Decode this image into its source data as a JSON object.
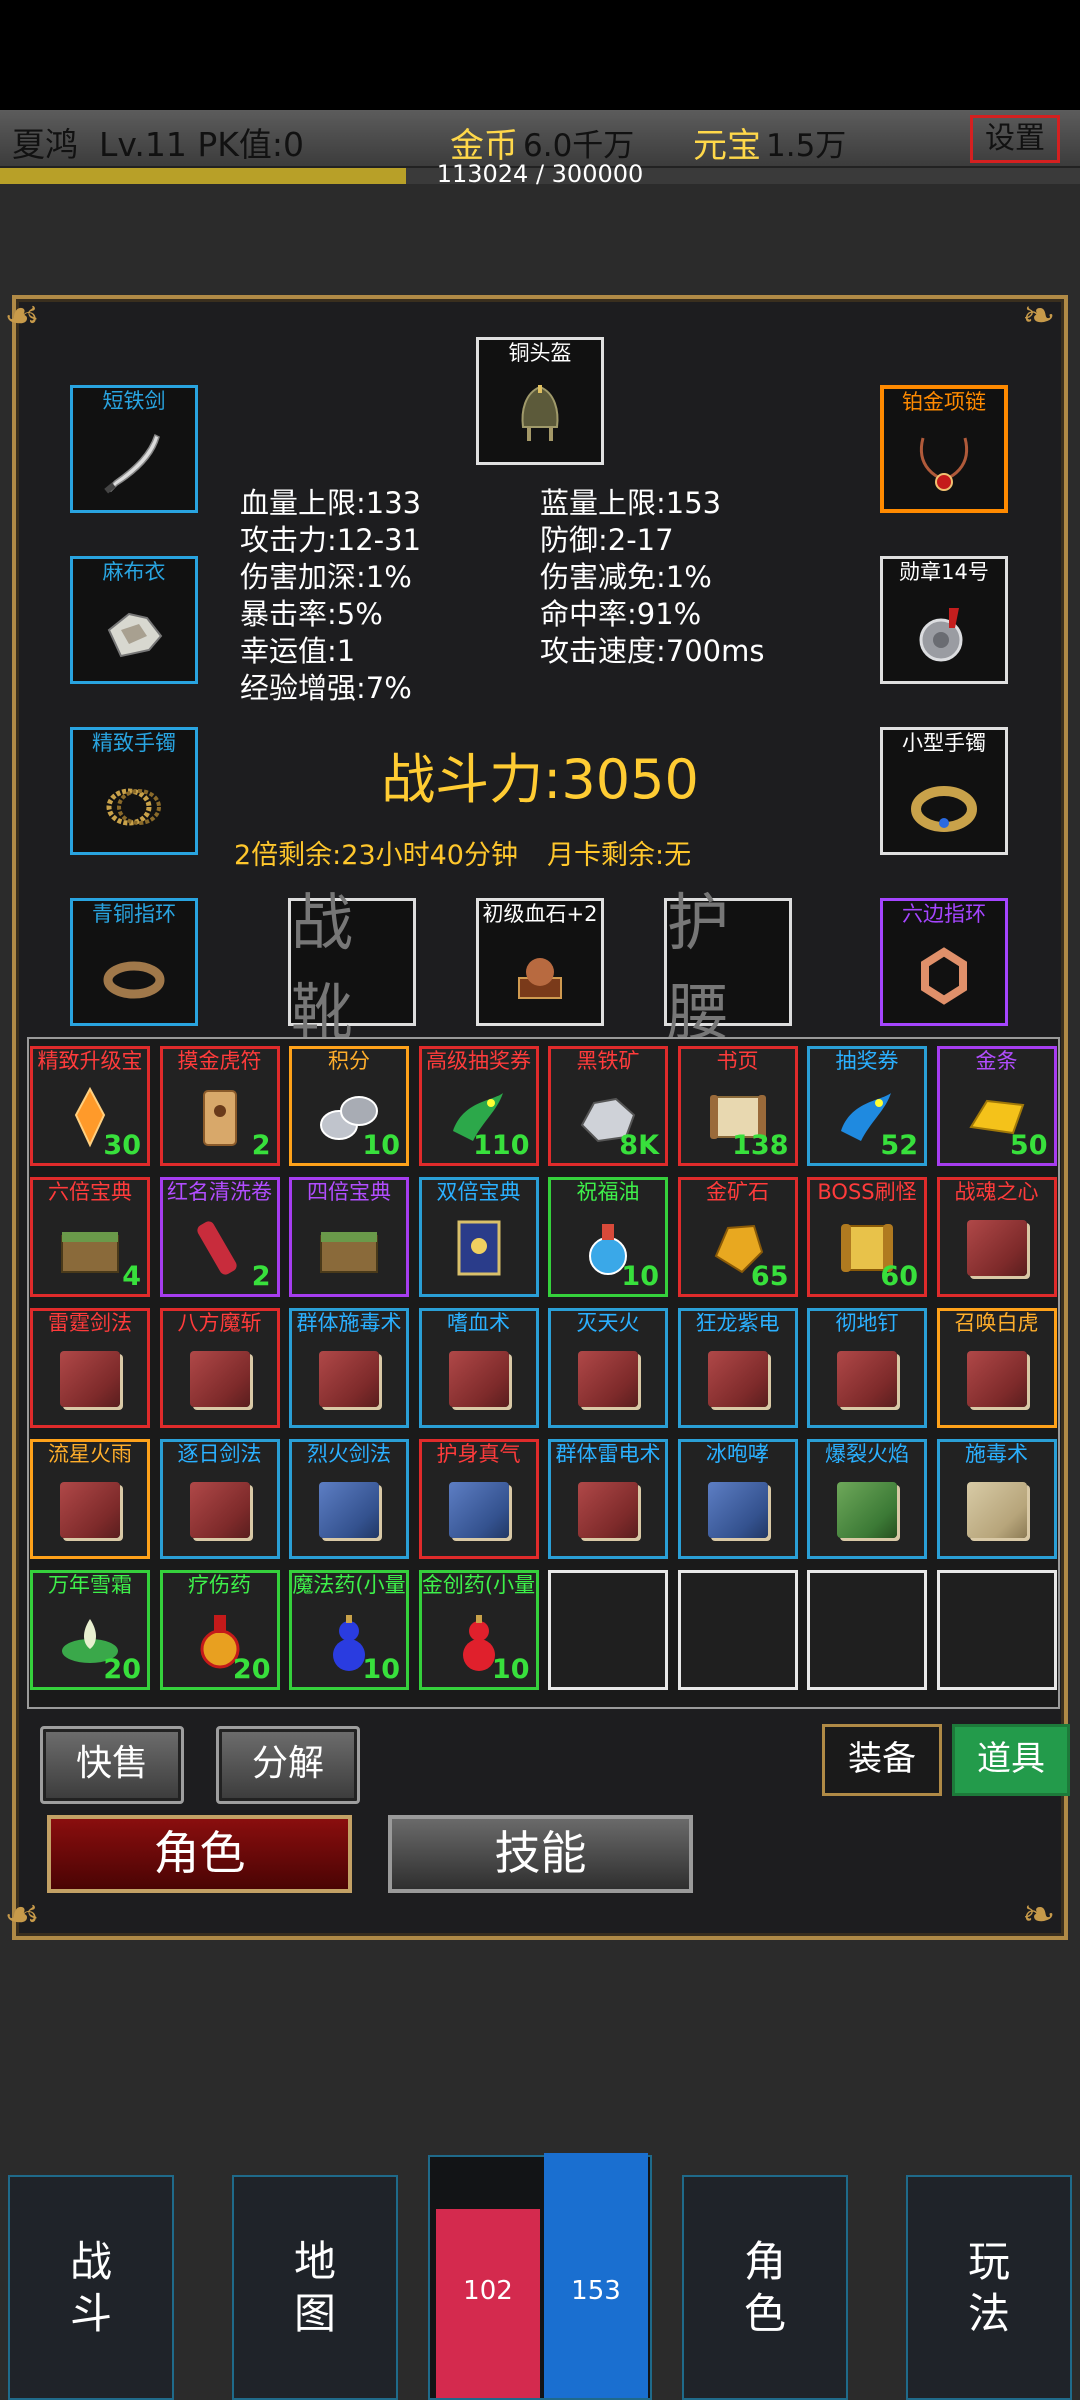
{
  "header": {
    "player_name": "夏鸿",
    "level": "Lv.11",
    "pk": "PK值:0",
    "gold_label": "金币",
    "gold_value": "6.0千万",
    "yuanbao_label": "元宝",
    "yuanbao_value": "1.5万",
    "settings_label": "设置",
    "exp_text": "113024 / 300000",
    "exp_progress": 0.376
  },
  "equipment": {
    "helmet": "铜头盔",
    "weapon": "短铁剑",
    "necklace": "铂金项链",
    "armor": "麻布衣",
    "medal": "勋章14号",
    "bracelet_left": "精致手镯",
    "bracelet_right": "小型手镯",
    "ring_left": "青铜指环",
    "boots": "战靴",
    "gem": "初级血石+2",
    "belt": "护腰",
    "ring_right": "六边指环"
  },
  "stats": {
    "hp": "血量上限:133",
    "mp": "蓝量上限:153",
    "atk": "攻击力:12-31",
    "def": "防御:2-17",
    "dmg_inc": "伤害加深:1%",
    "dmg_red": "伤害减免:1%",
    "crit": "暴击率:5%",
    "hit": "命中率:91%",
    "luck": "幸运值:1",
    "atk_speed": "攻击速度:700ms",
    "exp_boost": "经验增强:7%"
  },
  "power": "战斗力:3050",
  "double_remain": "2倍剩余:23小时40分钟",
  "month_card": "月卡剩余:无",
  "inventory": [
    {
      "name": "精致升级宝",
      "count": "30",
      "rarity": "red",
      "icon": "crystal-icon"
    },
    {
      "name": "摸金虎符",
      "count": "2",
      "rarity": "red",
      "icon": "tiger-tally-icon"
    },
    {
      "name": "积分",
      "count": "10",
      "rarity": "orange",
      "icon": "coins-icon"
    },
    {
      "name": "高级抽奖券",
      "count": "110",
      "rarity": "red",
      "icon": "green-dragon-icon"
    },
    {
      "name": "黑铁矿",
      "count": "8K",
      "rarity": "red",
      "icon": "ore-icon"
    },
    {
      "name": "书页",
      "count": "138",
      "rarity": "red",
      "icon": "scroll-icon"
    },
    {
      "name": "抽奖券",
      "count": "52",
      "rarity": "blue",
      "icon": "blue-dragon-icon"
    },
    {
      "name": "金条",
      "count": "50",
      "rarity": "purple",
      "icon": "gold-bar-icon"
    },
    {
      "name": "六倍宝典",
      "count": "4",
      "rarity": "red",
      "icon": "chest-icon"
    },
    {
      "name": "红名清洗卷",
      "count": "2",
      "rarity": "purple",
      "icon": "red-scroll-icon"
    },
    {
      "name": "四倍宝典",
      "count": "",
      "rarity": "purple",
      "icon": "chest-icon"
    },
    {
      "name": "双倍宝典",
      "count": "",
      "rarity": "blue",
      "icon": "blue-book-icon"
    },
    {
      "name": "祝福油",
      "count": "10",
      "rarity": "green",
      "icon": "potion-icon"
    },
    {
      "name": "金矿石",
      "count": "65",
      "rarity": "red",
      "icon": "gold-ore-icon"
    },
    {
      "name": "BOSS刷怪",
      "count": "60",
      "rarity": "red",
      "icon": "boss-scroll-icon"
    },
    {
      "name": "战魂之心",
      "count": "",
      "rarity": "red",
      "icon": "red-book-icon"
    },
    {
      "name": "雷霆剑法",
      "count": "",
      "rarity": "red",
      "icon": "red-book-icon"
    },
    {
      "name": "八方魔斩",
      "count": "",
      "rarity": "red",
      "icon": "red-book-icon"
    },
    {
      "name": "群体施毒术",
      "count": "",
      "rarity": "blue",
      "icon": "red-book-icon"
    },
    {
      "name": "嗜血术",
      "count": "",
      "rarity": "blue",
      "icon": "red-book-icon"
    },
    {
      "name": "灭天火",
      "count": "",
      "rarity": "blue",
      "icon": "red-book-icon"
    },
    {
      "name": "狂龙紫电",
      "count": "",
      "rarity": "blue",
      "icon": "red-book-icon"
    },
    {
      "name": "彻地钉",
      "count": "",
      "rarity": "blue",
      "icon": "red-book-icon"
    },
    {
      "name": "召唤白虎",
      "count": "",
      "rarity": "orange",
      "icon": "red-book-icon"
    },
    {
      "name": "流星火雨",
      "count": "",
      "rarity": "orange",
      "icon": "red-book-icon"
    },
    {
      "name": "逐日剑法",
      "count": "",
      "rarity": "blue",
      "icon": "red-book-icon"
    },
    {
      "name": "烈火剑法",
      "count": "",
      "rarity": "blue",
      "icon": "blue-book-icon"
    },
    {
      "name": "护身真气",
      "count": "",
      "rarity": "red",
      "icon": "blue-book-icon"
    },
    {
      "name": "群体雷电术",
      "count": "",
      "rarity": "blue",
      "icon": "red-book-icon"
    },
    {
      "name": "冰咆哮",
      "count": "",
      "rarity": "blue",
      "icon": "blue-book-icon"
    },
    {
      "name": "爆裂火焰",
      "count": "",
      "rarity": "blue",
      "icon": "green-book-icon"
    },
    {
      "name": "施毒术",
      "count": "",
      "rarity": "blue",
      "icon": "tan-book-icon"
    },
    {
      "name": "万年雪霜",
      "count": "20",
      "rarity": "green",
      "icon": "lotus-icon"
    },
    {
      "name": "疗伤药",
      "count": "20",
      "rarity": "green",
      "icon": "elixir-icon"
    },
    {
      "name": "魔法药(小量",
      "count": "10",
      "rarity": "green",
      "icon": "blue-gourd-icon"
    },
    {
      "name": "金创药(小量",
      "count": "10",
      "rarity": "green",
      "icon": "red-gourd-icon"
    },
    {
      "name": "",
      "count": "",
      "rarity": "empty",
      "icon": ""
    },
    {
      "name": "",
      "count": "",
      "rarity": "empty",
      "icon": ""
    },
    {
      "name": "",
      "count": "",
      "rarity": "empty",
      "icon": ""
    },
    {
      "name": "",
      "count": "",
      "rarity": "empty",
      "icon": ""
    }
  ],
  "actions": {
    "quick_sell": "快售",
    "decompose": "分解",
    "tab_equip": "装备",
    "tab_items": "道具",
    "role": "角色",
    "skills": "技能"
  },
  "bottom_nav": {
    "battle": "战\n斗",
    "map": "地\n图",
    "role": "角\n色",
    "play": "玩\n法",
    "hp_value": "102",
    "mp_value": "153",
    "hp_fill": 0.77,
    "mp_fill": 1.0
  },
  "colors": {
    "gold": "#ffd84a",
    "hp": "#d42a4e",
    "mp": "#1a6fd0",
    "panel_border": "#b08a46"
  }
}
